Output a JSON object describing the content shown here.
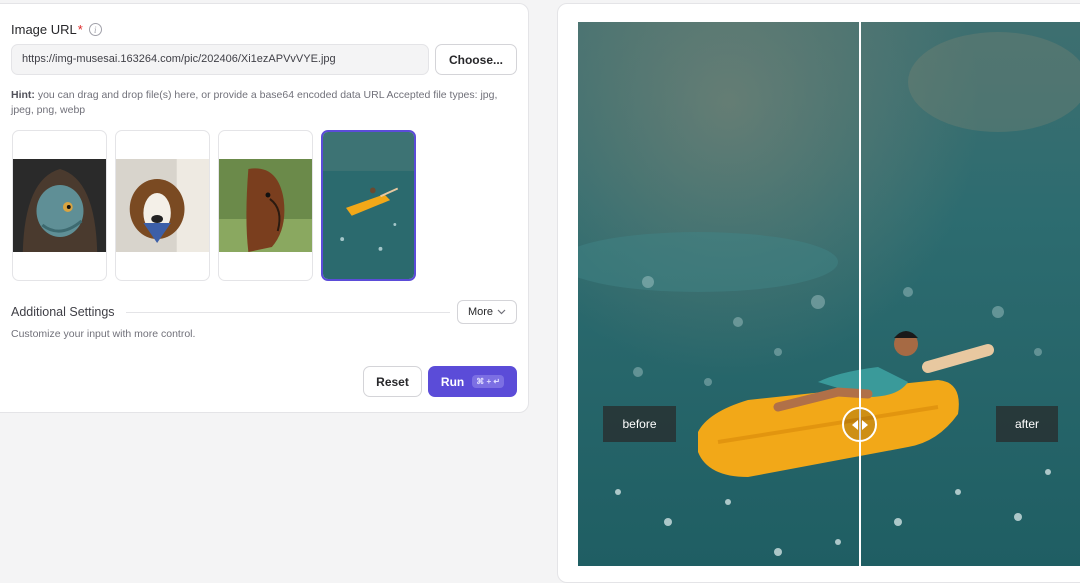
{
  "form": {
    "image_url_label": "Image URL",
    "required_mark": "*",
    "info_glyph": "i",
    "url_value": "https://img-musesai.163264.com/pic/202406/Xi1ezAPVvVYE.jpg",
    "choose_label": "Choose...",
    "hint_bold": "Hint:",
    "hint_text": " you can drag and drop file(s) here, or provide a base64 encoded data URL Accepted file types: jpg, jpeg, png, webp"
  },
  "thumbnails": [
    {
      "subject": "lizard in hood",
      "selected": false
    },
    {
      "subject": "dog with bandana",
      "selected": false
    },
    {
      "subject": "horse",
      "selected": false
    },
    {
      "subject": "person on popsicle raft",
      "selected": true
    }
  ],
  "settings": {
    "title": "Additional Settings",
    "more_label": "More",
    "subtitle": "Customize your input with more control."
  },
  "actions": {
    "reset_label": "Reset",
    "run_label": "Run",
    "run_shortcut": "⌘ + ↵"
  },
  "compare": {
    "before_label": "before",
    "after_label": "after"
  },
  "colors": {
    "accent": "#5b4cd8",
    "water": "#2b6a6e",
    "popsicle": "#f2a818"
  }
}
